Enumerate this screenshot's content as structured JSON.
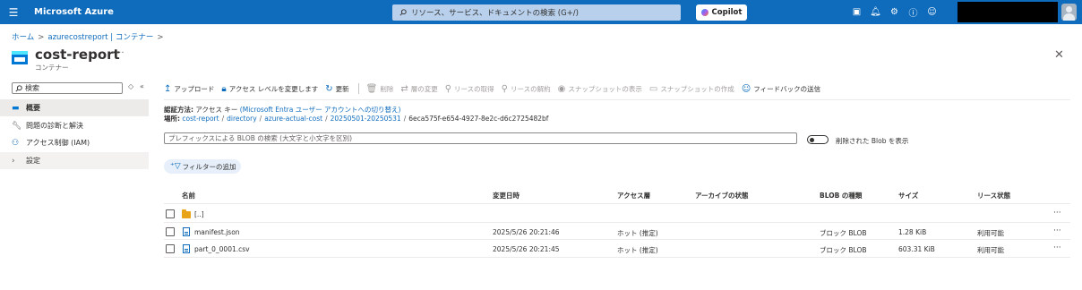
{
  "topbar": {
    "brand": "Microsoft Azure",
    "search_placeholder": "リソース、サービス、ドキュメントの検索 (G+/)",
    "copilot_label": "Copilot"
  },
  "breadcrumb": {
    "home": "ホーム",
    "parent": "azurecostreport | コンテナー"
  },
  "header": {
    "title": "cost-report",
    "subtitle": "コンテナー",
    "more": "···"
  },
  "nav": {
    "search_placeholder": "検索",
    "items": [
      {
        "label": "概要"
      },
      {
        "label": "問題の診断と解決"
      },
      {
        "label": "アクセス制御 (IAM)"
      },
      {
        "label": "設定"
      }
    ]
  },
  "toolbar": {
    "upload": "アップロード",
    "change_access": "アクセス レベルを変更します",
    "refresh": "更新",
    "delete": "削除",
    "change_tier": "層の変更",
    "acquire_lease": "リースの取得",
    "break_lease": "リースの解約",
    "show_snapshots": "スナップショットの表示",
    "create_snapshot": "スナップショットの作成",
    "feedback": "フィードバックの送信"
  },
  "auth": {
    "label": "認証方法:",
    "value": "アクセス キー",
    "link": "(Microsoft Entra ユーザー アカウントへの切り替え)"
  },
  "location": {
    "label": "場所:",
    "parts": [
      "cost-report",
      "directory",
      "azure-actual-cost",
      "20250501-20250531"
    ],
    "last": "6eca575f-e654-4927-8e2c-d6c2725482bf"
  },
  "blob_search": {
    "placeholder": "プレフィックスによる BLOB の検索 (大文字と小文字を区別)"
  },
  "toggle": {
    "label": "削除された Blob を表示"
  },
  "filter": {
    "label": "フィルターの追加"
  },
  "table": {
    "columns": [
      "名前",
      "変更日時",
      "アクセス層",
      "アーカイブの状態",
      "BLOB の種類",
      "サイズ",
      "リース状態"
    ],
    "rows": [
      {
        "name": "[..]",
        "modified": "",
        "tier": "",
        "archive": "",
        "type": "",
        "size": "",
        "lease": "",
        "kind": "folder"
      },
      {
        "name": "manifest.json",
        "modified": "2025/5/26 20:21:46",
        "tier": "ホット (推定)",
        "archive": "",
        "type": "ブロック BLOB",
        "size": "1.28 KiB",
        "lease": "利用可能",
        "kind": "file"
      },
      {
        "name": "part_0_0001.csv",
        "modified": "2025/5/26 20:21:45",
        "tier": "ホット (推定)",
        "archive": "",
        "type": "ブロック BLOB",
        "size": "603.31 KiB",
        "lease": "利用可能",
        "kind": "file"
      }
    ],
    "row_more": "···"
  }
}
